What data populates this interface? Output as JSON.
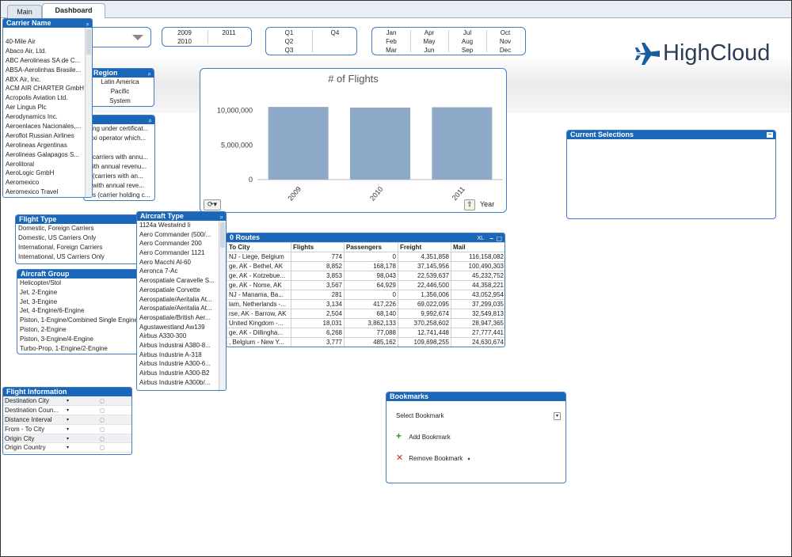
{
  "tabs": [
    {
      "label": "Main"
    },
    {
      "label": "Dashboard"
    }
  ],
  "brand": {
    "name": "HighCloud",
    "accent": "#1a5d9e"
  },
  "colors": {
    "caption_bg": "#1a66b8",
    "bar": "#8ea9c8",
    "border": "#3f7cc1"
  },
  "icons": {
    "search": "magnifier",
    "minimize": "minus",
    "maximize": "square",
    "xl": "excel-export",
    "add": "plus",
    "remove": "x"
  },
  "carrier_name": {
    "title": "Carrier Name",
    "items": [
      "40-Mile Air",
      "Abaco Air, Ltd.",
      "ABC Aerolineas SA de C...",
      "ABSA-Aerolinhas Brasile...",
      "ABX Air, Inc.",
      "ACM AIR CHARTER GmbH",
      "Acropolis Aviation Ltd.",
      "Aer Lingus Plc",
      "Aerodynamics Inc.",
      "Aeroenlaces Nacionales,...",
      "Aeroflot Russian Airlines",
      "Aerolineas Argentinas",
      "Aerolineas Galapagos S...",
      "Aerolitoral",
      "AeroLogic GmbH",
      "Aeromexico",
      "Aeromexico Travel"
    ]
  },
  "years": {
    "items": [
      "2009",
      "2011",
      "2010"
    ]
  },
  "quarters": {
    "items": [
      "Q1",
      "Q4",
      "Q2",
      "Q3"
    ]
  },
  "months": {
    "items": [
      "Jan",
      "Apr",
      "Jul",
      "Oct",
      "Feb",
      "May",
      "Aug",
      "Nov",
      "Mar",
      "Jun",
      "Sep",
      "Dec"
    ]
  },
  "region": {
    "title": "Region",
    "items": [
      "Latin America",
      "Pacific",
      "System"
    ]
  },
  "carrier_group": {
    "items": [
      "ng under certificat...",
      "xi operator which...",
      "",
      "carriers with annu...",
      "ith annual revenu...",
      " (carriers with an...",
      " with annual reve...",
      "s (carrier holding c..."
    ]
  },
  "chart_data": {
    "type": "bar",
    "title": "# of Flights",
    "xlabel": "Year",
    "ylabel": "",
    "categories": [
      "2009",
      "2010",
      "2011"
    ],
    "values": [
      10500000,
      10400000,
      10450000
    ],
    "ylim": [
      0,
      12000000
    ],
    "yticks": [
      "10,000,000",
      "5,000,000",
      "0"
    ],
    "grid": false,
    "legend": "none"
  },
  "current_selections": {
    "title": "Current Selections"
  },
  "flight_type": {
    "title": "Flight Type",
    "items": [
      "Domestic, Foreign Carriers",
      "Domestic, US Carriers Only",
      "International, Foreign Carriers",
      "International, US Carriers Only"
    ]
  },
  "aircraft_group": {
    "title": "Aircraft Group",
    "items": [
      "Helicopter/Stol",
      "Jet, 2-Engine",
      "Jet, 3-Engine",
      "Jet, 4-Engine/6-Engine",
      "Piston,  1-Engine/Combined Single Engine",
      "Piston, 2-Engine",
      "Piston, 3-Engine/4-Engine",
      "Turbo-Prop, 1-Engine/2-Engine"
    ]
  },
  "aircraft_type": {
    "title": "Aircraft Type",
    "items": [
      "1124a Westwind Ii",
      "Aero Commander (500/...",
      "Aero Commander 200",
      "Aero Commander 1121",
      "Aero Macchi Al-60",
      "Aeronca 7-Ac",
      "Aerospatiale Caravelle S...",
      "Aerospatiale Corvette",
      "Aerospatiale/Aeritalia At...",
      "Aerospatiale/Aeritalia At...",
      "Aerospatiale/British Aer...",
      "Agustawestland Aw139",
      "Airbus A330-300",
      "Airbus Industrai A380-8...",
      "Airbus Industrie A-318",
      "Airbus Industrie A300-6...",
      "Airbus Industrie A300-B2",
      "Airbus Industrie A300b/..."
    ]
  },
  "routes": {
    "title": "0 Routes",
    "xl": "XL",
    "columns": [
      "To City",
      "Flights",
      "Passengers",
      "Freight",
      "Mail"
    ],
    "rows": [
      [
        "NJ - Liege, Belgium",
        "774",
        "0",
        "4,351,858",
        "116,158,082"
      ],
      [
        "ge, AK - Bethel, AK",
        "8,852",
        "168,178",
        "37,145,956",
        "100,490,303"
      ],
      [
        "ge, AK - Kotzebue...",
        "3,853",
        "98,043",
        "22,539,637",
        "45,232,752"
      ],
      [
        "ge, AK - Nome, AK",
        "3,567",
        "64,929",
        "22,446,500",
        "44,358,221"
      ],
      [
        "NJ - Manama, Ba...",
        "281",
        "0",
        "1,356,006",
        "43,052,954"
      ],
      [
        "lam, Netherlands -...",
        "3,134",
        "417,226",
        "69,022,095",
        "37,299,035"
      ],
      [
        "rse, AK - Barrow, AK",
        "2,504",
        "68,140",
        "9,992,674",
        "32,549,813"
      ],
      [
        "United Kingdom -...",
        "18,031",
        "3,862,133",
        "370,258,602",
        "28,947,365"
      ],
      [
        "ge, AK - Dillingha...",
        "6,268",
        "77,088",
        "12,741,448",
        "27,777,441"
      ],
      [
        ", Belgium - New Y...",
        "3,777",
        "485,162",
        "109,698,255",
        "24,630,674"
      ]
    ]
  },
  "flight_info": {
    "title": "Flight Information",
    "items": [
      "Destination City",
      "Destination Coun...",
      "Distance Interval",
      "From - To City",
      "Origin City",
      "Origin Country"
    ]
  },
  "bookmarks": {
    "title": "Bookmarks",
    "select": "Select Bookmark",
    "add": "Add Bookmark",
    "remove": "Remove Bookmark"
  }
}
